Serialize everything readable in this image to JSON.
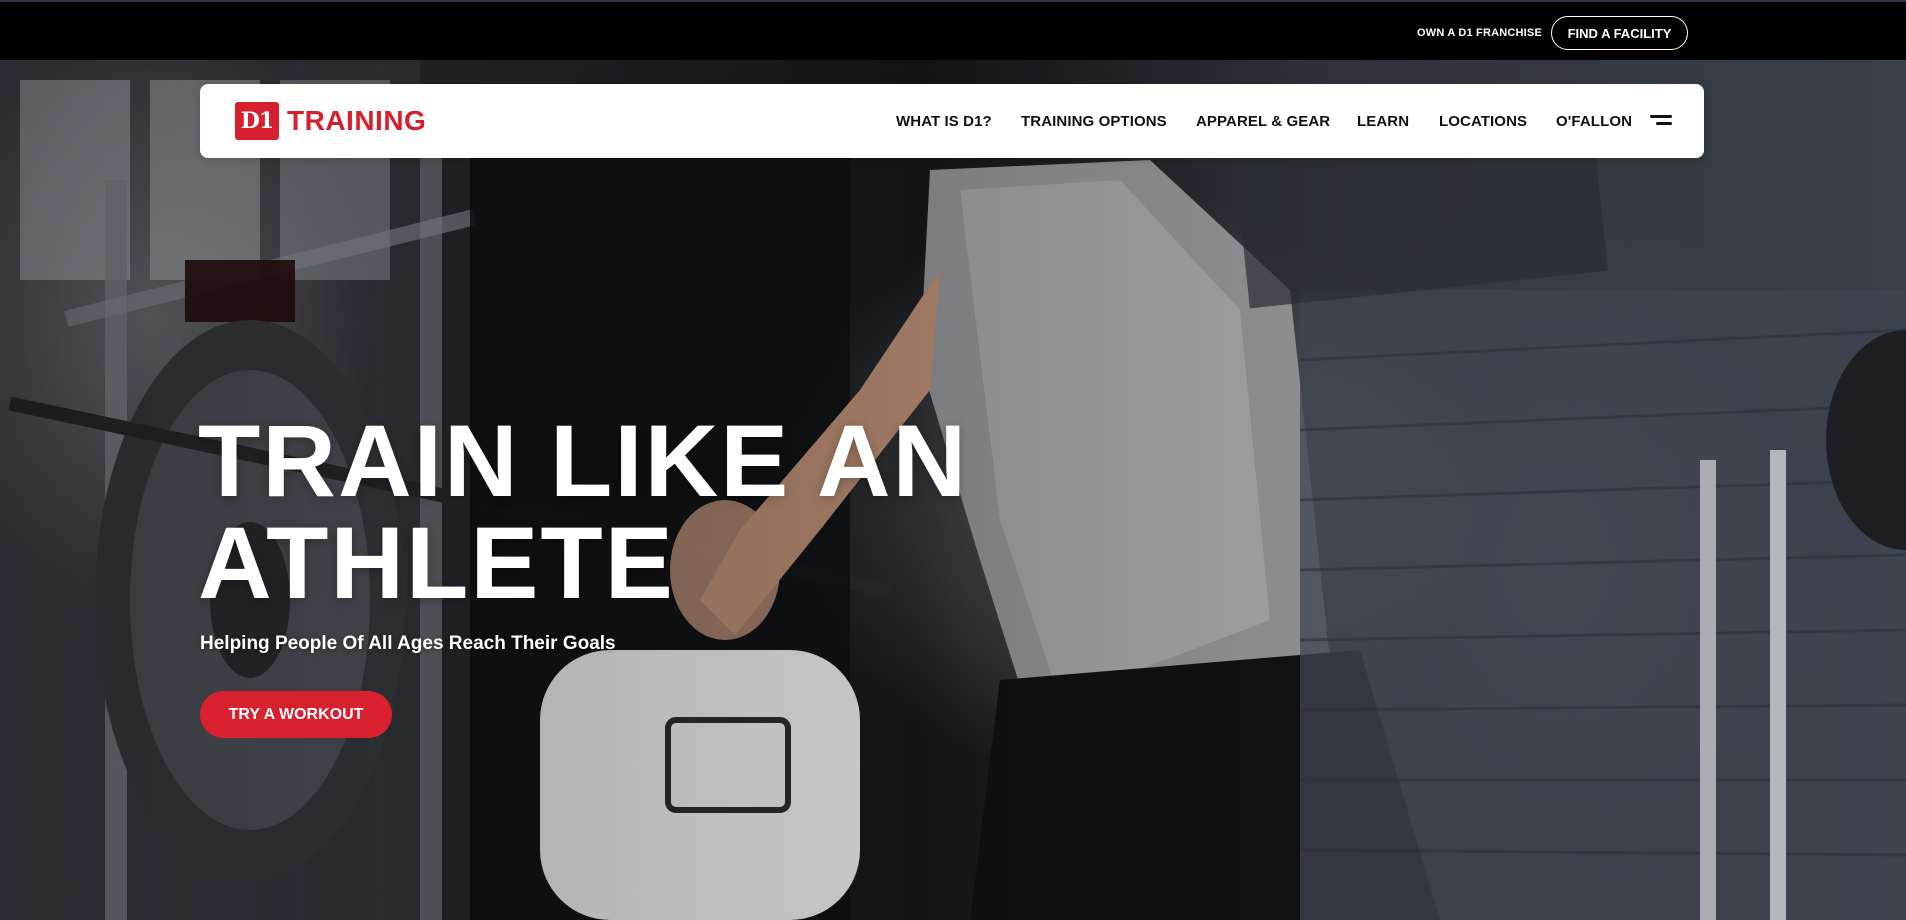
{
  "utility_bar": {
    "franchise_link": "OWN A D1 FRANCHISE",
    "find_facility_button": "FIND A FACILITY"
  },
  "brand": {
    "logo_mark": "D1",
    "logo_text": "TRAINING",
    "brand_color": "#d62030"
  },
  "nav": {
    "items": [
      {
        "label": "WHAT IS D1?"
      },
      {
        "label": "TRAINING OPTIONS"
      },
      {
        "label": "APPAREL & GEAR"
      },
      {
        "label": "LEARN"
      },
      {
        "label": "LOCATIONS"
      },
      {
        "label": "O'FALLON"
      }
    ],
    "menu_icon": "hamburger-menu-icon"
  },
  "hero": {
    "headline_line1": "TRAIN LIKE AN",
    "headline_line2": "ATHLETE",
    "subheadline": "Helping People Of All Ages Reach Their Goals",
    "cta_label": "TRY A WORKOUT",
    "cta_color": "#d9202f",
    "background": "gym-training-photo"
  }
}
